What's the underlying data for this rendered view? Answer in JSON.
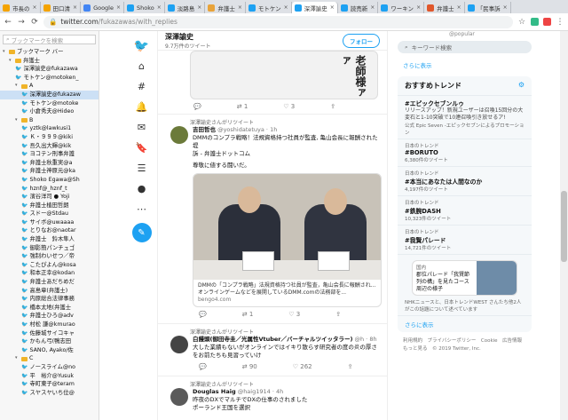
{
  "tabs": [
    {
      "label": "市長の",
      "color": "#f4a300"
    },
    {
      "label": "田口清",
      "color": "#f4a300"
    },
    {
      "label": "Google",
      "color": "#4285f4"
    },
    {
      "label": "Shoko",
      "color": "#1da1f2"
    },
    {
      "label": "淡路島",
      "color": "#1da1f2"
    },
    {
      "label": "弁護士",
      "color": "#e8a33a"
    },
    {
      "label": "モトケン",
      "color": "#1da1f2"
    },
    {
      "label": "深澤諭史",
      "color": "#1da1f2",
      "active": true
    },
    {
      "label": "読売新",
      "color": "#1da1f2"
    },
    {
      "label": "ワーキン",
      "color": "#1da1f2"
    },
    {
      "label": "弁護士",
      "color": "#e0572c"
    },
    {
      "label": "「民事訴",
      "color": "#1da1f2"
    }
  ],
  "address": {
    "host": "twitter.com",
    "path": "/fukazawas/with_replies"
  },
  "bookmarks": {
    "search_placeholder": "ブックマークを検索",
    "items": [
      {
        "label": "ブックマーク バー",
        "kind": "folder",
        "indent": 0
      },
      {
        "label": "弁護士",
        "kind": "folder",
        "indent": 1
      },
      {
        "label": "深澤諭史@fukazawa",
        "kind": "tw",
        "indent": 2
      },
      {
        "label": "モトケン@motoken_",
        "kind": "tw",
        "indent": 2
      },
      {
        "label": "A",
        "kind": "folder",
        "indent": 2
      },
      {
        "label": "深澤諭史@fukazaw",
        "kind": "tw",
        "indent": 3,
        "selected": true
      },
      {
        "label": "モトケン@motoke",
        "kind": "tw",
        "indent": 3
      },
      {
        "label": "小倉秀夫@Hideo",
        "kind": "tw",
        "indent": 3
      },
      {
        "label": "B",
        "kind": "folder",
        "indent": 2
      },
      {
        "label": "yztk@lawkusi1",
        "kind": "tw",
        "indent": 3
      },
      {
        "label": "Ｋ・９９９@kiki",
        "kind": "tw",
        "indent": 3
      },
      {
        "label": "吾久出大輝@kik",
        "kind": "tw",
        "indent": 3
      },
      {
        "label": "ヨコテン刑事弁護",
        "kind": "tw",
        "indent": 3
      },
      {
        "label": "弁護士秋重実@a",
        "kind": "tw",
        "indent": 3
      },
      {
        "label": "弁護士神原元@ka",
        "kind": "tw",
        "indent": 3
      },
      {
        "label": "Shoko Egawa@Sh",
        "kind": "tw",
        "indent": 3
      },
      {
        "label": "hznf@_hznf_t",
        "kind": "tw",
        "indent": 3
      },
      {
        "label": "濱谷洋司 ● Yoji",
        "kind": "tw",
        "indent": 3
      },
      {
        "label": "弁護士植田哲朗",
        "kind": "tw",
        "indent": 3
      },
      {
        "label": "スドー@Stdau",
        "kind": "tw",
        "indent": 3
      },
      {
        "label": "サイボ@uwaaaa",
        "kind": "tw",
        "indent": 3
      },
      {
        "label": "とりなお@naotar",
        "kind": "tw",
        "indent": 3
      },
      {
        "label": "弁護士　鈴木隼人",
        "kind": "tw",
        "indent": 3
      },
      {
        "label": "御影簡パンチュゴ",
        "kind": "tw",
        "indent": 3
      },
      {
        "label": "強制わいせつ／帝",
        "kind": "tw",
        "indent": 3
      },
      {
        "label": "こたぴよん@kosa",
        "kind": "tw",
        "indent": 3
      },
      {
        "label": "和本正幸@kodan",
        "kind": "tw",
        "indent": 3
      },
      {
        "label": "弁護士あだちめだ",
        "kind": "tw",
        "indent": 3
      },
      {
        "label": "高島章(弁護士)",
        "kind": "tw",
        "indent": 3
      },
      {
        "label": "内原総合法律事務",
        "kind": "tw",
        "indent": 3
      },
      {
        "label": "橋本太地(弁護士",
        "kind": "tw",
        "indent": 3
      },
      {
        "label": "弁護士ひろ@adv",
        "kind": "tw",
        "indent": 3
      },
      {
        "label": "村松 謙@kmurao",
        "kind": "tw",
        "indent": 3
      },
      {
        "label": "佐藤城サイコキャ",
        "kind": "tw",
        "indent": 3
      },
      {
        "label": "かもん弓(鴨志田",
        "kind": "tw",
        "indent": 3
      },
      {
        "label": "SANO, Ayako/佐",
        "kind": "tw",
        "indent": 3
      },
      {
        "label": "C",
        "kind": "folder",
        "indent": 2
      },
      {
        "label": "ノースライム@no",
        "kind": "tw",
        "indent": 3
      },
      {
        "label": "平　裕介@Yusuk",
        "kind": "tw",
        "indent": 3
      },
      {
        "label": "寺町東子@teram",
        "kind": "tw",
        "indent": 3
      },
      {
        "label": "スヤスヤいち位@",
        "kind": "tw",
        "indent": 3
      }
    ]
  },
  "profile": {
    "name": "深澤諭史",
    "tweets_count": "9.7万件のツイート",
    "follow_label": "フォロー"
  },
  "first_tweet": {
    "manga_text": "老師様ァァ",
    "replies": "",
    "retweets": "1",
    "likes": "3"
  },
  "tweets": [
    {
      "retweet_label": "深澤諭史さんがリツイート",
      "name": "吉田哲也",
      "handle": "@yoshidatetuya · 1h",
      "text1": "DMMのコンプラ戦略！法規資格持つ社員が監査, 亀山会長に報酬された堤",
      "text2": "訴 - 弁護士ドットコム",
      "text3": "尊敬に値する闘いだ。",
      "card_title": "DMMの「コンプラ戦略」法規資格持つ社員が監査，亀山会長に報酬され...",
      "card_desc": "オンラインゲームなどを展開しているDMM.comの法務部を...",
      "card_link": "bengo4.com",
      "replies": "",
      "retweets": "1",
      "likes": "3",
      "avatar_color": "#6b7a3a"
    },
    {
      "retweet_label": "深澤諭史さんがリツイート",
      "name": "白饅頭(御田寺圭／光属性Vtuber／バーチャルツイッタラー)",
      "handle": "@h · 8h",
      "text1": "大した業績もないがオンラインではイキり散らす研究者の度の炎の厚さをお前たちも見習っていけ",
      "replies": "",
      "retweets": "90",
      "likes": "262",
      "avatar_color": "#444"
    },
    {
      "retweet_label": "深澤諭史さんがリツイート",
      "name": "Douglas Haig",
      "handle": "@haig1914 · 4h",
      "text1": "昨夜のDXでマルチでDXの仕事のされました",
      "text2": "ポーランド王国を選択",
      "avatar_color": "#5a5a5a"
    }
  ],
  "right": {
    "top_ctx": "@popular",
    "search_placeholder": "キーワード検索",
    "more_label": "さらに表示",
    "trends_title": "おすすめトレンド",
    "trends": [
      {
        "meta": "",
        "name": "#エピックセブンルゥ",
        "desc": "リリースアップ！新規ユーザーは召喚15回分の大変石と1-10突破で10連召喚引き放せるア!",
        "count": "公式 Epic Seven -エピックセブンによるプロモーション"
      },
      {
        "meta": "日本のトレンド",
        "name": "#BORUTO",
        "count": "6,380件のツイート"
      },
      {
        "meta": "日本のトレンド",
        "name": "#本当にあなたは人間なのか",
        "count": "4,197件のツイート"
      },
      {
        "meta": "日本のトレンド",
        "name": "#鉄腕DASH",
        "count": "10,323件のツイート"
      },
      {
        "meta": "日本のトレンド",
        "name": "#我賢パレード",
        "count": "14,721件のツイート"
      }
    ],
    "news_meta": "国内",
    "news_title": "郡位パレード「我賢節列の構」を見たコース周辺の様子",
    "news_source": "NHKニュースと、日本トレンドWEST さんたち他2人がこの話題について述べています",
    "trends_more": "さらに表示",
    "footer": "利用規約　プライバシーポリシー　Cookie　広告情報　もっと見る　© 2019 Twitter, Inc."
  }
}
